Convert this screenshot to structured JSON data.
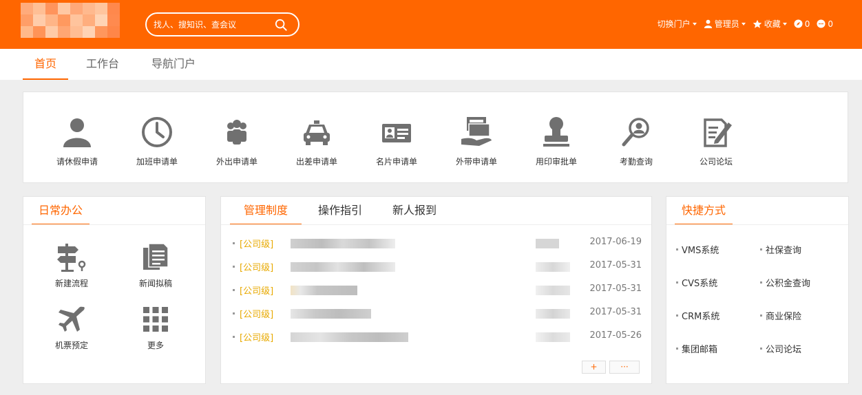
{
  "header": {
    "search_placeholder": "找人、搜知识、查会议",
    "switch_portal": "切换门户",
    "admin": "管理员",
    "favorites": "收藏",
    "todo_count": "0",
    "msg_count": "0"
  },
  "main_tabs": [
    "首页",
    "工作台",
    "导航门户"
  ],
  "apps": [
    {
      "label": "请休假申请",
      "icon": "user-icon"
    },
    {
      "label": "加班申请单",
      "icon": "clock-icon"
    },
    {
      "label": "外出申请单",
      "icon": "group-icon"
    },
    {
      "label": "出差申请单",
      "icon": "taxi-icon"
    },
    {
      "label": "名片申请单",
      "icon": "id-card-icon"
    },
    {
      "label": "外带申请单",
      "icon": "hand-box-icon"
    },
    {
      "label": "用印审批单",
      "icon": "stamp-icon"
    },
    {
      "label": "考勤查询",
      "icon": "search-person-icon"
    },
    {
      "label": "公司论坛",
      "icon": "edit-doc-icon"
    }
  ],
  "daily": {
    "title": "日常办公",
    "items": [
      {
        "label": "新建流程",
        "icon": "signpost-icon"
      },
      {
        "label": "新闻拟稿",
        "icon": "document-icon"
      },
      {
        "label": "机票预定",
        "icon": "airplane-icon"
      },
      {
        "label": "更多",
        "icon": "grid-icon"
      }
    ]
  },
  "management": {
    "tabs": [
      "管理制度",
      "操作指引",
      "新人报到"
    ],
    "rows": [
      {
        "level": "[公司级]",
        "date": "2017-06-19"
      },
      {
        "level": "[公司级]",
        "date": "2017-05-31"
      },
      {
        "level": "[公司级]",
        "date": "2017-05-31"
      },
      {
        "level": "[公司级]",
        "date": "2017-05-31"
      },
      {
        "level": "[公司级]",
        "date": "2017-05-26"
      }
    ],
    "add_label": "+",
    "more_label": "···"
  },
  "quick": {
    "title": "快捷方式",
    "links": [
      "VMS系统",
      "社保查询",
      "CVS系统",
      "公积金查询",
      "CRM系统",
      "商业保险",
      "集团邮箱",
      "公司论坛"
    ]
  },
  "colors": {
    "brand": "#ff6600",
    "level": "#e8a900"
  }
}
